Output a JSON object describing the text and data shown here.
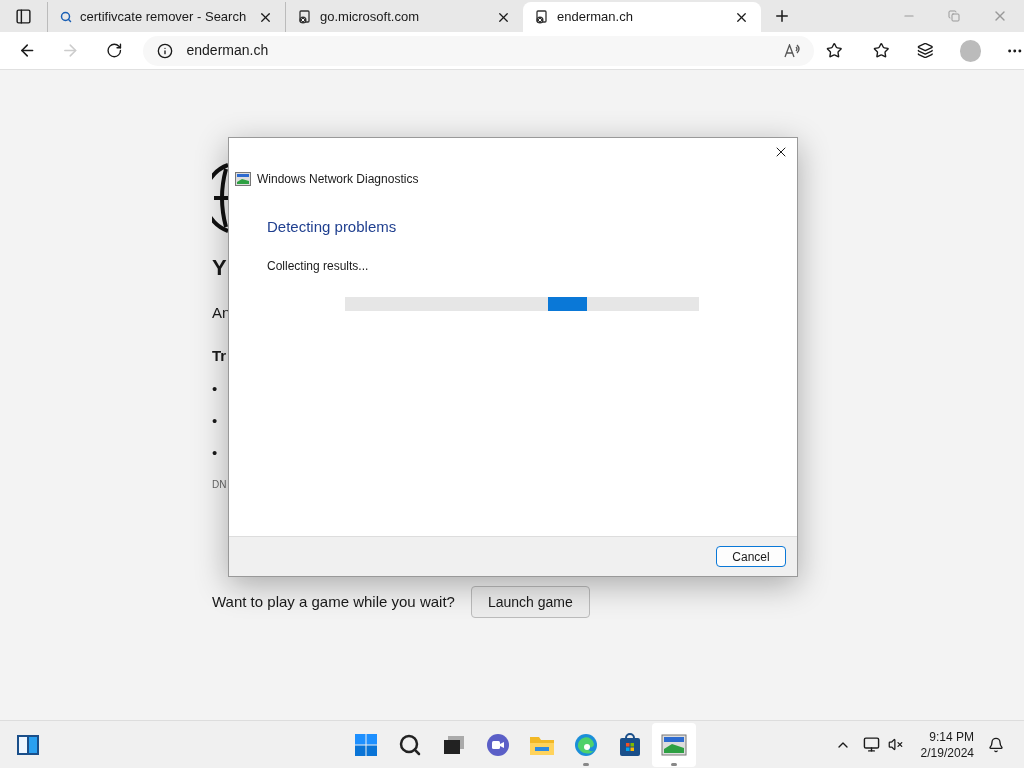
{
  "tabs": [
    {
      "title": "certifivcate remover - Search",
      "kind": "search",
      "selected": false
    },
    {
      "title": "go.microsoft.com",
      "kind": "error",
      "selected": false
    },
    {
      "title": "enderman.ch",
      "kind": "error",
      "selected": true
    }
  ],
  "address": "enderman.ch",
  "page": {
    "heading": "Y",
    "intro": "An",
    "try_heading": "Tr",
    "bullets": [
      "•",
      "•",
      "•"
    ],
    "code": "DN",
    "game_prompt": "Want to play a game while you wait?",
    "game_button": "Launch game"
  },
  "dialog": {
    "title": "Windows Network Diagnostics",
    "heading": "Detecting problems",
    "status": "Collecting results...",
    "cancel": "Cancel"
  },
  "taskbar": {
    "apps": [
      {
        "kind": "start",
        "running": false
      },
      {
        "kind": "search",
        "running": false
      },
      {
        "kind": "taskview",
        "running": false
      },
      {
        "kind": "chat",
        "running": false
      },
      {
        "kind": "files",
        "running": false
      },
      {
        "kind": "edge",
        "running": true
      },
      {
        "kind": "store",
        "running": false
      },
      {
        "kind": "diagnostics",
        "running": true
      }
    ],
    "time": "9:14 PM",
    "date": "2/19/2024"
  }
}
